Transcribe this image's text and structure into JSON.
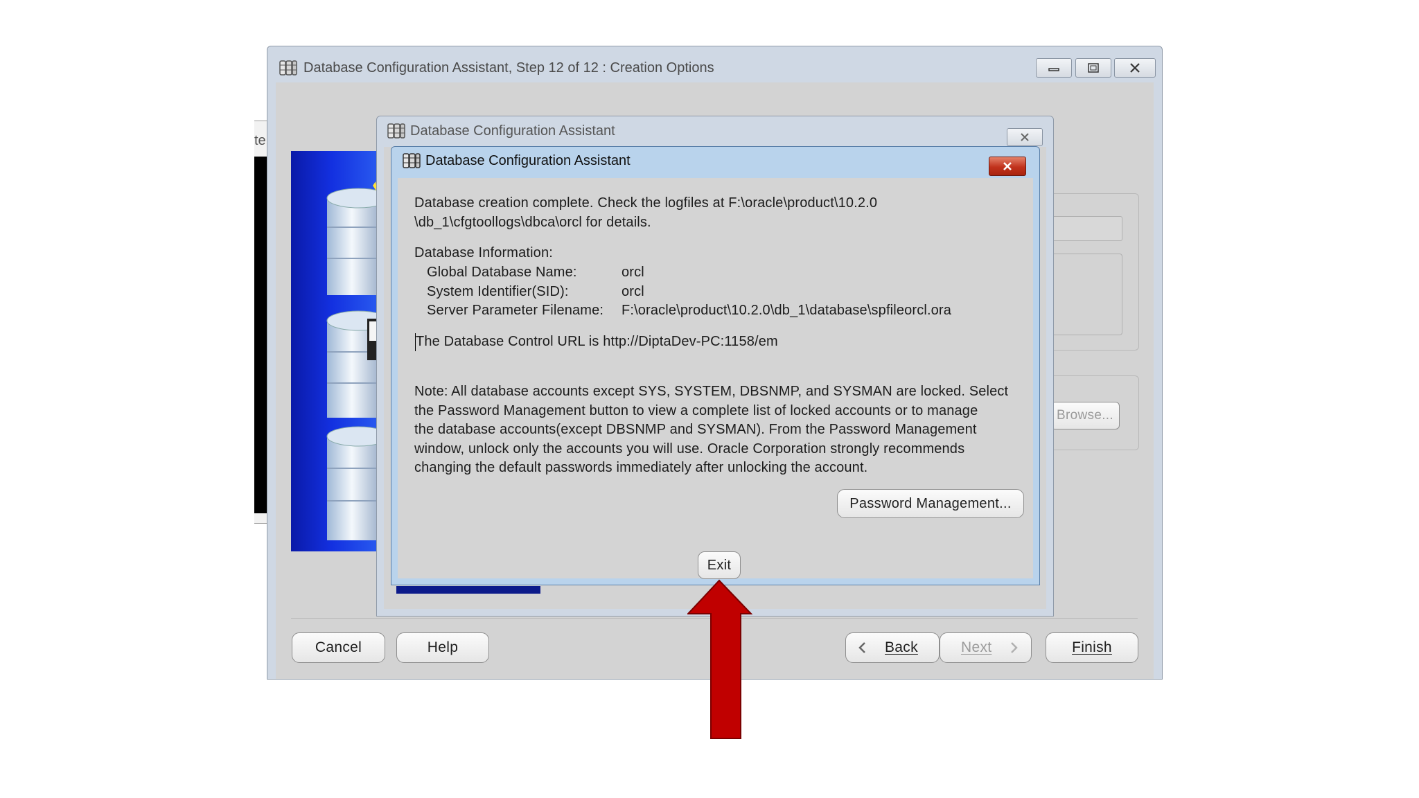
{
  "outer_window": {
    "title": "Database Configuration Assistant, Step 12 of 12 : Creation Options",
    "left_edge_text": "te",
    "buttons": {
      "cancel": "Cancel",
      "help": "Help",
      "back": "Back",
      "next": "Next",
      "finish": "Finish"
    },
    "browse_button": "Browse..."
  },
  "middle_dialog": {
    "title": "Database Configuration Assistant"
  },
  "front_dialog": {
    "title": "Database Configuration Assistant",
    "completion_line1": "Database creation complete. Check the logfiles at F:\\oracle\\product\\10.2.0",
    "completion_line2": "\\db_1\\cfgtoollogs\\dbca\\orcl for details.",
    "info_heading": "Database Information:",
    "info_rows": [
      {
        "label": "Global Database Name:",
        "value": "orcl"
      },
      {
        "label": "System Identifier(SID):",
        "value": "orcl"
      },
      {
        "label": "Server Parameter Filename:",
        "value": "F:\\oracle\\product\\10.2.0\\db_1\\database\\spfileorcl.ora"
      }
    ],
    "control_url_line": "The Database Control URL is http://DiptaDev-PC:1158/em",
    "note_lines": [
      "Note: All database accounts except SYS, SYSTEM, DBSNMP, and SYSMAN are locked. Select",
      "the Password Management button to view a complete list of locked accounts or to manage",
      "the database accounts(except DBSNMP and SYSMAN). From the Password Management",
      "window, unlock only the accounts you will use. Oracle Corporation strongly recommends",
      "changing the default passwords immediately after unlocking the account."
    ],
    "password_button": "Password Management...",
    "exit_button": "Exit"
  },
  "colors": {
    "annotation_arrow": "#c00000",
    "close_button": "#c1321c"
  }
}
